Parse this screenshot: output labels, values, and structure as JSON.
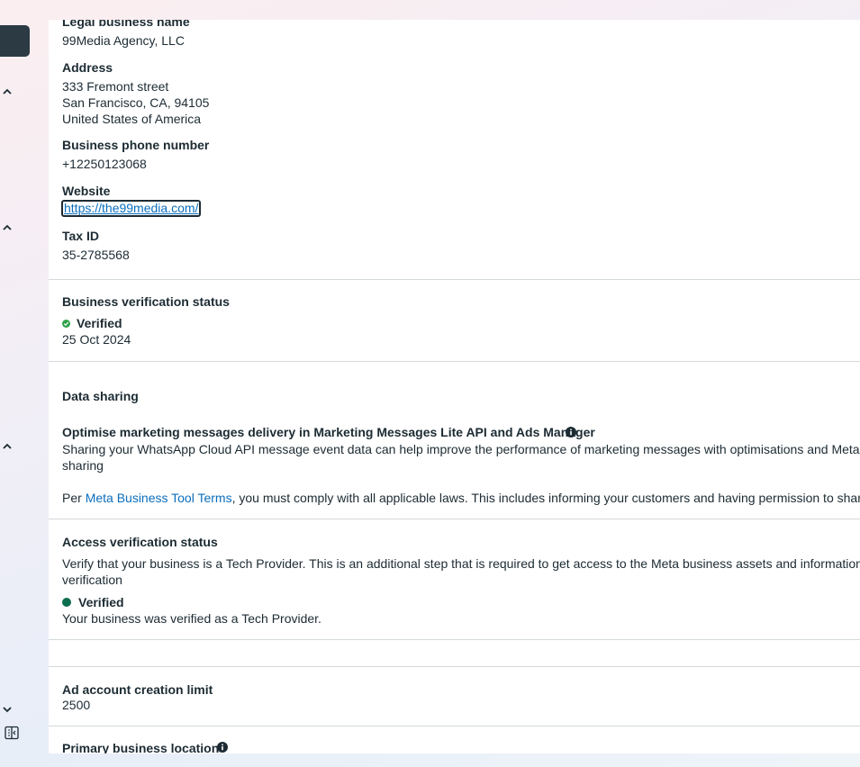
{
  "business_info": {
    "legal_name_label": "Legal business name",
    "legal_name_value": "99Media Agency, LLC",
    "address_label": "Address",
    "address_line1": "333 Fremont street",
    "address_line2": "San Francisco, CA, 94105",
    "address_line3": "United States of America",
    "phone_label": "Business phone number",
    "phone_value": "+12250123068",
    "website_label": "Website",
    "website_value": "https://the99media.com/",
    "tax_id_label": "Tax ID",
    "tax_id_value": "35-2785568"
  },
  "verification": {
    "title": "Business verification status",
    "status": "Verified",
    "date": "25 Oct 2024",
    "status_color": "#31a24c"
  },
  "data_sharing": {
    "title": "Data sharing",
    "subtitle": "Optimise marketing messages delivery in Marketing Messages Lite API and Ads Manager",
    "desc": "Sharing your WhatsApp Cloud API message event data can help improve the performance of marketing messages with optimisations and Meta ads. This inc",
    "desc_link": "sharing",
    "terms_prefix": "Per ",
    "terms_link": "Meta Business Tool Terms",
    "terms_suffix": ", you must comply with all applicable laws. This includes informing your customers and having permission to share data with M"
  },
  "access_verification": {
    "title": "Access verification status",
    "desc": "Verify that your business is a Tech Provider. This is an additional step that is required to get access to the Meta business assets and information of other bus",
    "desc_link": "verification",
    "status": "Verified",
    "status_desc": "Your business was verified as a Tech Provider.",
    "status_color": "#0b6e4f"
  },
  "ad_limit": {
    "title": "Ad account creation limit",
    "value": "2500"
  },
  "primary_location": {
    "title": "Primary business location"
  },
  "icons": {
    "rail": [
      "chevron-up-icon",
      "chevron-up-icon",
      "chevron-up-icon",
      "chevron-down-icon",
      "panel-toggle-icon"
    ],
    "info": "info-icon",
    "check": "check-circle-icon"
  }
}
